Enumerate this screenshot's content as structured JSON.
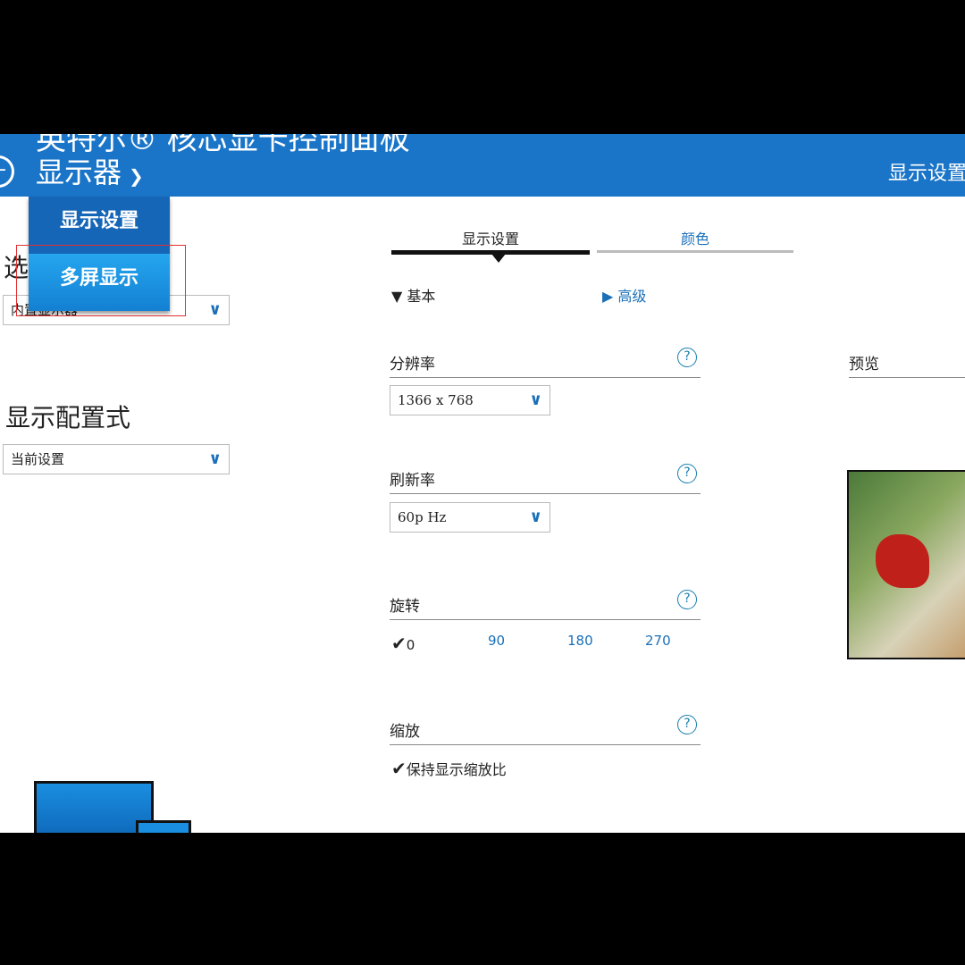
{
  "header": {
    "app_title": "英特尔® 核芯显卡控制面板",
    "section": "显示器",
    "right_label": "显示设置"
  },
  "menu": {
    "items": [
      {
        "label": "显示设置"
      },
      {
        "label": "多屏显示"
      }
    ]
  },
  "left": {
    "select_display_label": "选",
    "select_display_value": "内置显示器",
    "profile_label": "显示配置式",
    "profile_value": "当前设置"
  },
  "tabs": [
    {
      "label": "显示设置",
      "active": true
    },
    {
      "label": "颜色",
      "active": false
    }
  ],
  "modes": {
    "basic": "基本",
    "advanced": "高级"
  },
  "resolution": {
    "label": "分辨率",
    "value": "1366 x 768"
  },
  "refresh": {
    "label": "刷新率",
    "value": "60p Hz"
  },
  "rotation": {
    "label": "旋转",
    "options": [
      "0",
      "90",
      "180",
      "270"
    ],
    "selected": "0"
  },
  "scaling": {
    "label": "缩放",
    "option": "保持显示缩放比",
    "checked": true
  },
  "preview": {
    "label": "预览"
  },
  "help_glyph": "?",
  "colors": {
    "header": "#1a75c8",
    "accent": "#1a6fb8",
    "menu_highlight": "#25a6ef"
  }
}
